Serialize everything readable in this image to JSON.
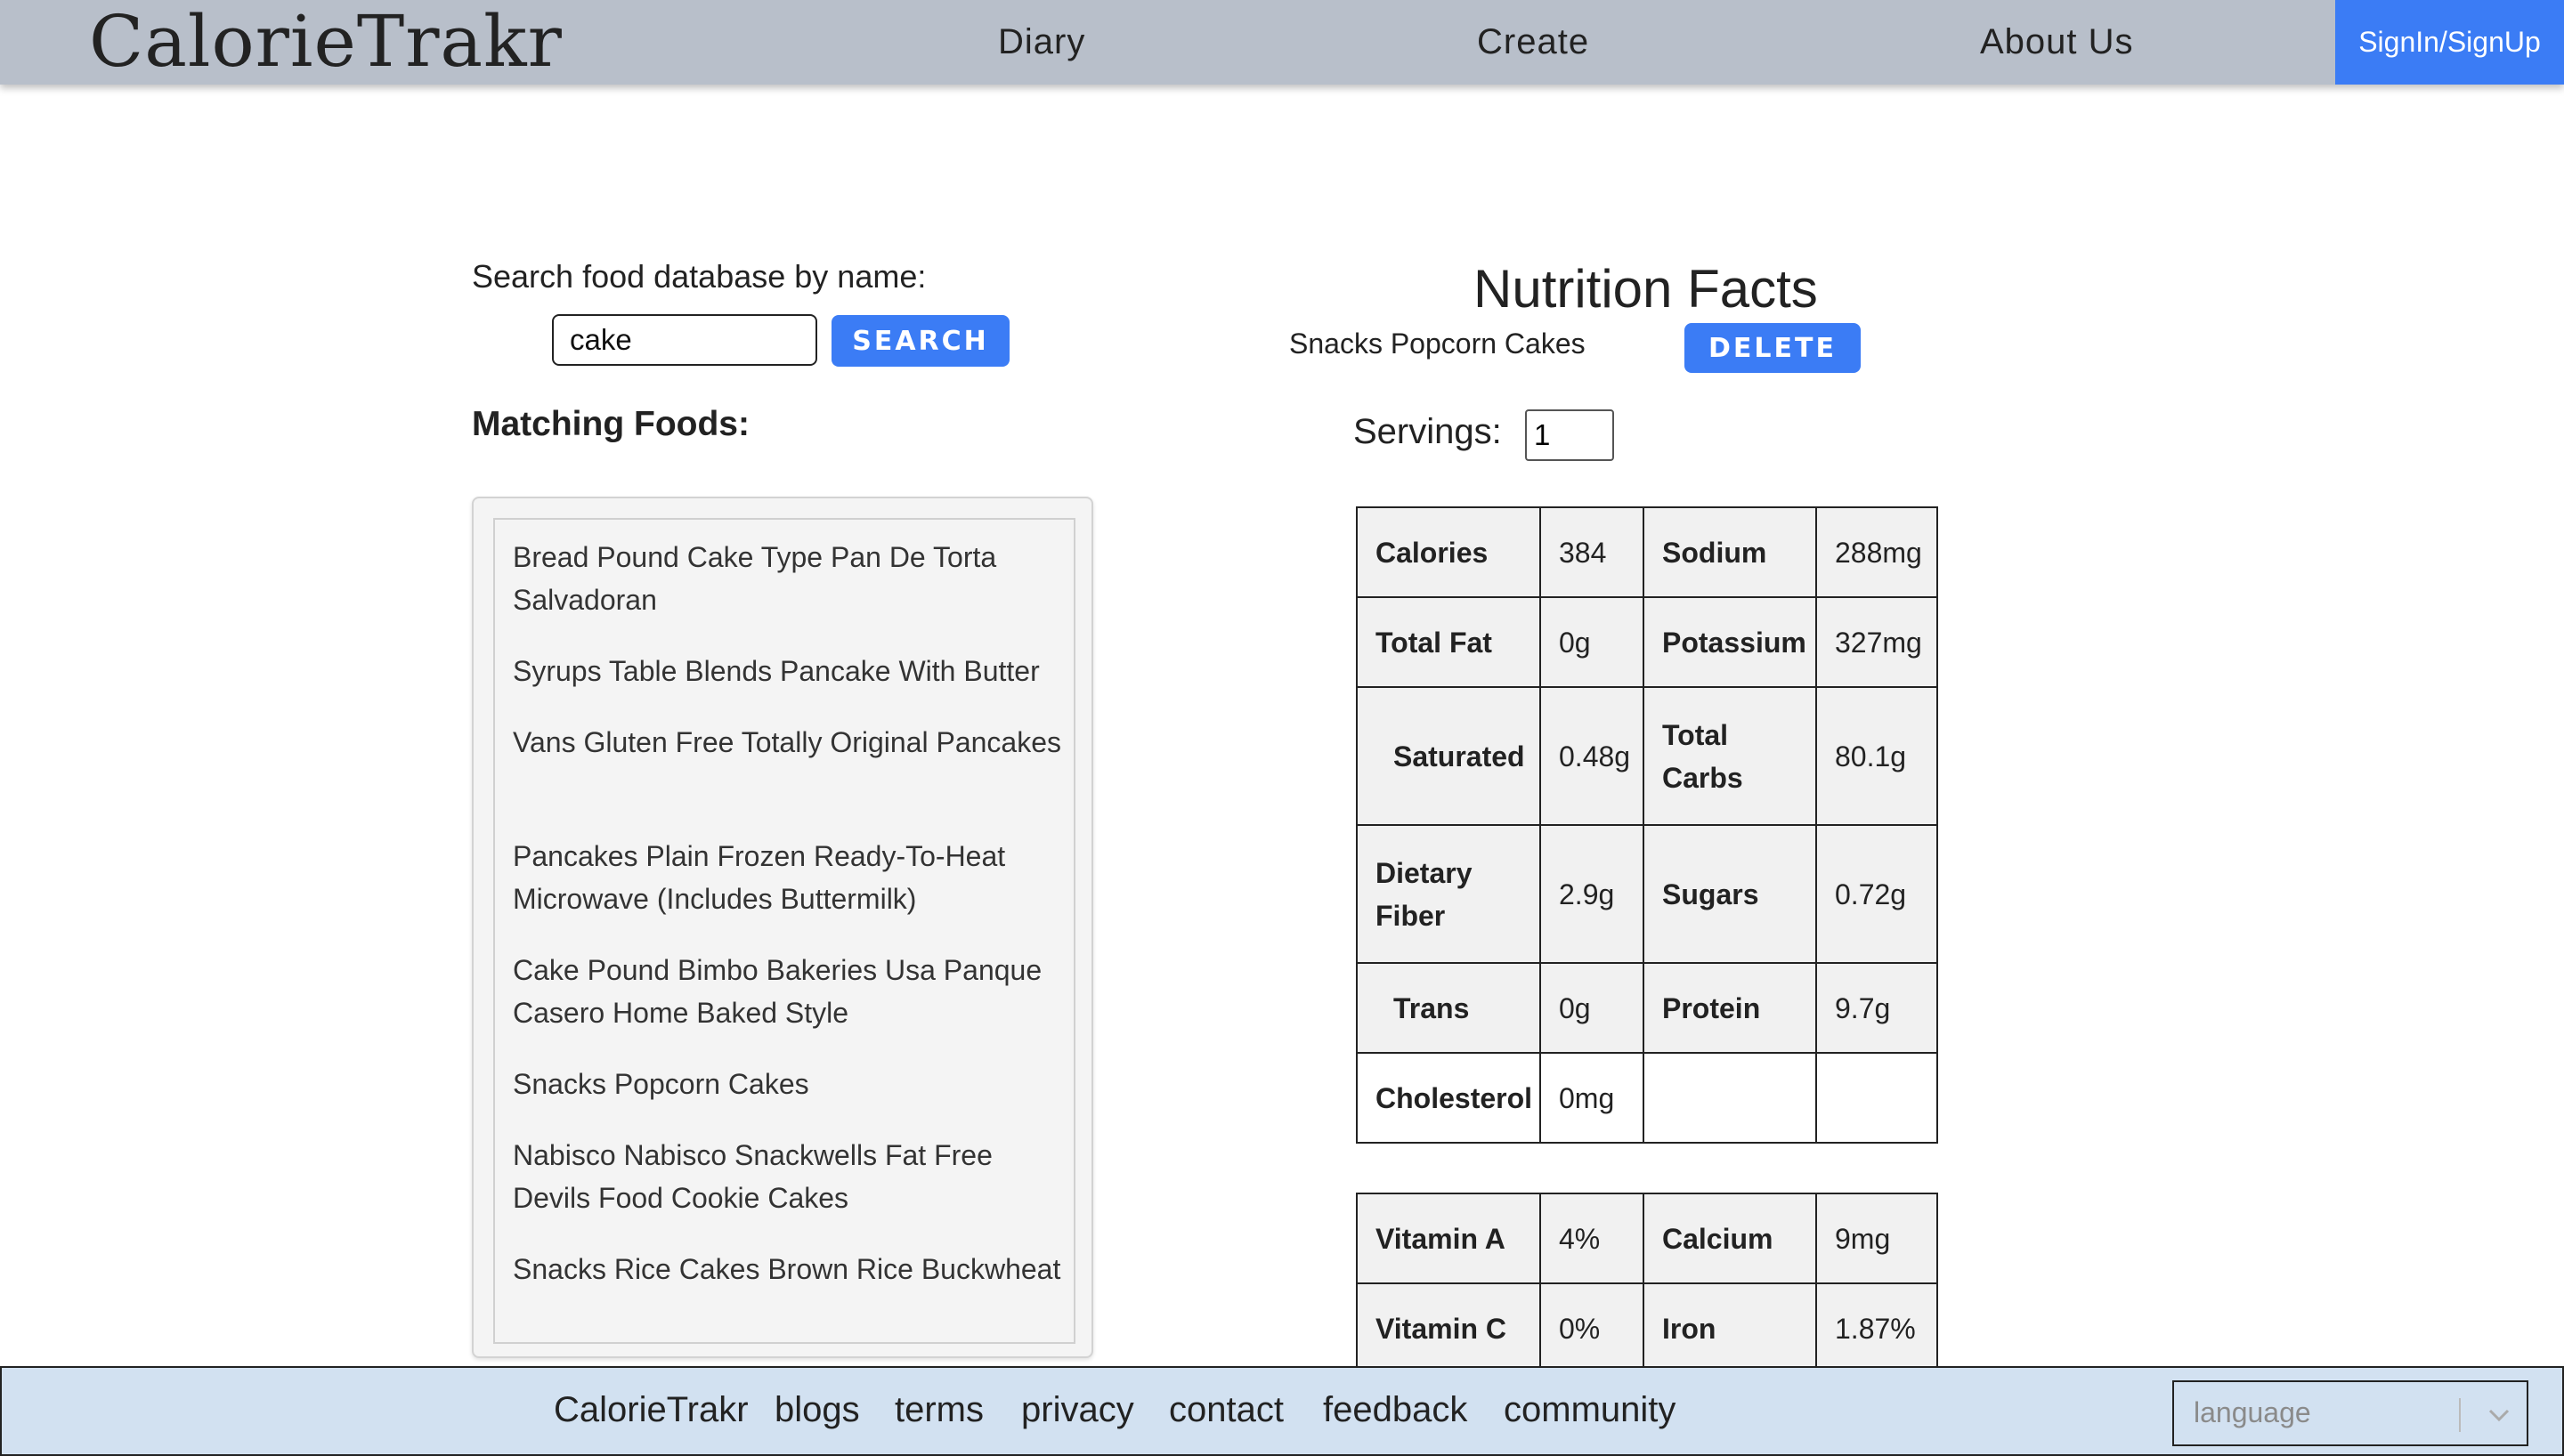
{
  "header": {
    "logo": "CalorieTrakr",
    "nav": [
      "Diary",
      "Create",
      "About Us"
    ],
    "signin_label": "SignIn/SignUp"
  },
  "search": {
    "label": "Search food database by name:",
    "value": "cake",
    "button_label": "SEARCH"
  },
  "matching": {
    "title": "Matching Foods:",
    "items": [
      "Bread Pound Cake Type Pan De Torta Salvadoran",
      "Syrups Table Blends Pancake With Butter",
      "Vans Gluten Free Totally Original Pancakes",
      "Pancakes Plain Frozen Ready-To-Heat Microwave (Includes Buttermilk)",
      "Cake Pound Bimbo Bakeries Usa Panque Casero Home Baked Style",
      "Snacks Popcorn Cakes",
      "Nabisco Nabisco Snackwells Fat Free Devils Food Cookie Cakes",
      "Snacks Rice Cakes Brown Rice Buckwheat"
    ]
  },
  "nutrition": {
    "title": "Nutrition Facts",
    "food_name": "Snacks Popcorn Cakes",
    "delete_label": "DELETE",
    "servings_label": "Servings:",
    "servings_value": "1",
    "rows": [
      [
        "Calories",
        "384",
        "Sodium",
        "288mg"
      ],
      [
        "Total Fat",
        "0g",
        "Potassium",
        "327mg"
      ],
      [
        "Saturated",
        "0.48g",
        "Total Carbs",
        "80.1g"
      ],
      [
        "Dietary Fiber",
        "2.9g",
        "Sugars",
        "0.72g"
      ],
      [
        "Trans",
        "0g",
        "Protein",
        "9.7g"
      ],
      [
        "Cholesterol",
        "0mg",
        "",
        ""
      ]
    ],
    "vitamin_rows": [
      [
        "Vitamin A",
        "4%",
        "Calcium",
        "9mg"
      ],
      [
        "Vitamin C",
        "0%",
        "Iron",
        "1.87%"
      ]
    ]
  },
  "footer": {
    "links": [
      "CalorieTrakr",
      "blogs",
      "terms",
      "privacy",
      "contact",
      "feedback",
      "community"
    ],
    "language_placeholder": "language"
  },
  "colors": {
    "navbar": "#b8bfca",
    "accent": "#3b7cf5",
    "footer": "#d2e1f1"
  }
}
